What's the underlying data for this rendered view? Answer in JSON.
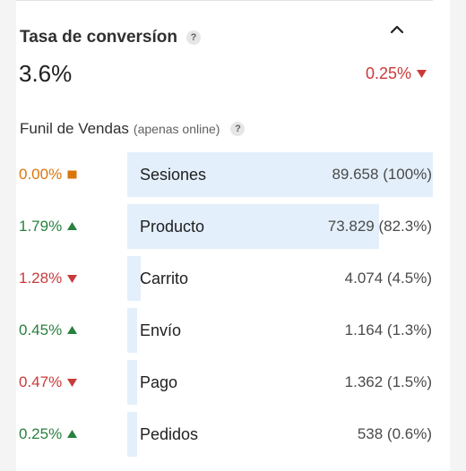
{
  "metric": {
    "title": "Tasa de conversíon",
    "help_glyph": "?",
    "value": "3.6%",
    "delta": "0.25%",
    "delta_direction": "down",
    "collapse_icon": "chevron-up-icon"
  },
  "funnel": {
    "title": "Funil de Vendas",
    "subtitle": "(apenas online)",
    "help_glyph": "?",
    "stages": [
      {
        "change": "0.00%",
        "trend": "neutral",
        "label": "Sesiones",
        "count": "89.658 (100%)",
        "share": 1.0
      },
      {
        "change": "1.79%",
        "trend": "up",
        "label": "Producto",
        "count": "73.829 (82.3%)",
        "share": 0.823
      },
      {
        "change": "1.28%",
        "trend": "down",
        "label": "Carrito",
        "count": "4.074 (4.5%)",
        "share": 0.045
      },
      {
        "change": "0.45%",
        "trend": "up",
        "label": "Envío",
        "count": "1.164 (1.3%)",
        "share": 0.013
      },
      {
        "change": "0.47%",
        "trend": "down",
        "label": "Pago",
        "count": "1.362 (1.5%)",
        "share": 0.015
      },
      {
        "change": "0.25%",
        "trend": "up",
        "label": "Pedidos",
        "count": "538 (0.6%)",
        "share": 0.006
      }
    ]
  },
  "colors": {
    "up": "#29803f",
    "down": "#c93a3a",
    "neutral": "#d9760a",
    "bar": "#e3effb"
  }
}
